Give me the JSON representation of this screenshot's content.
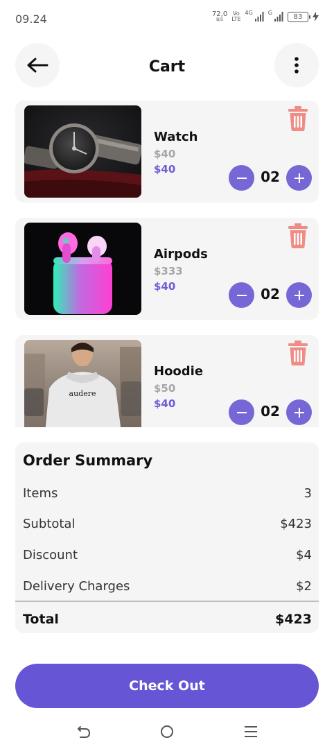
{
  "status_bar": {
    "time": "09.24",
    "net_speed": "72,0",
    "net_speed_unit": "B/S",
    "volte_top": "Vo",
    "volte_bottom": "LTE",
    "net_type_1": "4G",
    "net_type_2": "G",
    "battery": "83"
  },
  "header": {
    "title": "Cart",
    "back_icon": "arrow-left-icon",
    "menu_icon": "more-vertical-icon"
  },
  "cart": {
    "items": [
      {
        "name": "Watch",
        "old_price": "$40",
        "price": "$40",
        "quantity": "02",
        "image": "watch-photo"
      },
      {
        "name": "Airpods",
        "old_price": "$333",
        "price": "$40",
        "quantity": "02",
        "image": "airpods-photo"
      },
      {
        "name": "Hoodie",
        "old_price": "$50",
        "price": "$40",
        "quantity": "02",
        "image": "hoodie-photo",
        "shirt_text": "audere"
      }
    ]
  },
  "summary": {
    "title": "Order Summary",
    "rows": [
      {
        "label": "Items",
        "value": "3"
      },
      {
        "label": "Subtotal",
        "value": "$423"
      },
      {
        "label": "Discount",
        "value": "$4"
      },
      {
        "label": "Delivery Charges",
        "value": "$2"
      }
    ],
    "total_label": "Total",
    "total_value": "$423"
  },
  "checkout": {
    "label": "Check Out"
  },
  "colors": {
    "accent": "#6656d6",
    "qty_button": "#7667d6",
    "price": "#6e5dd3",
    "old_price": "#a6a6a6",
    "trash": "#f08c86",
    "card_bg": "#f5f5f5"
  },
  "nav": {
    "back_icon": "nav-back-icon",
    "home_icon": "nav-home-icon",
    "recents_icon": "nav-recents-icon"
  }
}
